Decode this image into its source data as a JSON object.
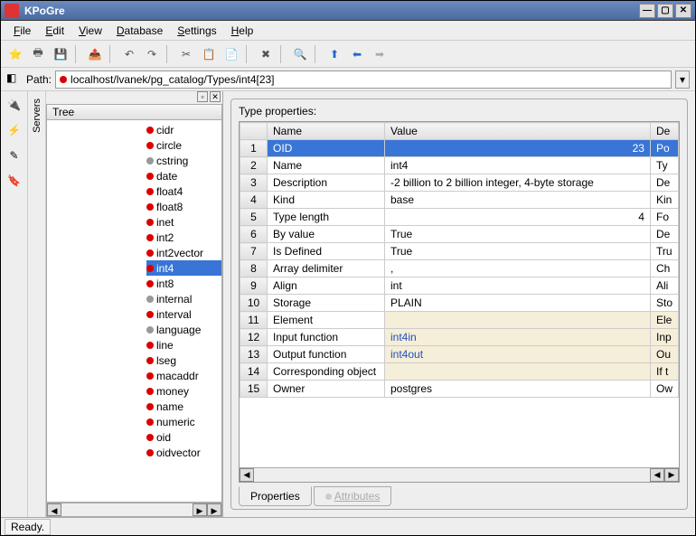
{
  "window": {
    "title": "KPoGre"
  },
  "menu": {
    "items": [
      "File",
      "Edit",
      "View",
      "Database",
      "Settings",
      "Help"
    ]
  },
  "path": {
    "label": "Path:",
    "value": "localhost/lvanek/pg_catalog/Types/int4[23]"
  },
  "sidebar": {
    "label": "Servers"
  },
  "tree": {
    "header": "Tree",
    "items": [
      {
        "name": "cidr",
        "color": "red"
      },
      {
        "name": "circle",
        "color": "red"
      },
      {
        "name": "cstring",
        "color": "grey"
      },
      {
        "name": "date",
        "color": "red"
      },
      {
        "name": "float4",
        "color": "red"
      },
      {
        "name": "float8",
        "color": "red"
      },
      {
        "name": "inet",
        "color": "red"
      },
      {
        "name": "int2",
        "color": "red"
      },
      {
        "name": "int2vector",
        "color": "red"
      },
      {
        "name": "int4",
        "color": "red",
        "selected": true
      },
      {
        "name": "int8",
        "color": "red"
      },
      {
        "name": "internal",
        "color": "grey"
      },
      {
        "name": "interval",
        "color": "red"
      },
      {
        "name": "language",
        "color": "grey"
      },
      {
        "name": "line",
        "color": "red"
      },
      {
        "name": "lseg",
        "color": "red"
      },
      {
        "name": "macaddr",
        "color": "red"
      },
      {
        "name": "money",
        "color": "red"
      },
      {
        "name": "name",
        "color": "red"
      },
      {
        "name": "numeric",
        "color": "red"
      },
      {
        "name": "oid",
        "color": "red"
      },
      {
        "name": "oidvector",
        "color": "red"
      }
    ]
  },
  "properties": {
    "title": "Type properties:",
    "columns": {
      "num": "",
      "name": "Name",
      "value": "Value",
      "desc": "De"
    },
    "rows": [
      {
        "n": "1",
        "name": "OID",
        "value": "23",
        "d": "Po",
        "selected": true,
        "ralign": true
      },
      {
        "n": "2",
        "name": "Name",
        "value": "int4",
        "d": "Ty"
      },
      {
        "n": "3",
        "name": "Description",
        "value": "-2 billion to 2 billion integer, 4-byte storage",
        "d": "De"
      },
      {
        "n": "4",
        "name": "Kind",
        "value": "base",
        "d": "Kin"
      },
      {
        "n": "5",
        "name": "Type length",
        "value": "4",
        "d": "Fo",
        "ralign": true
      },
      {
        "n": "6",
        "name": "By value",
        "value": "True",
        "d": "De"
      },
      {
        "n": "7",
        "name": "Is Defined",
        "value": "True",
        "d": "Tru"
      },
      {
        "n": "8",
        "name": "Array delimiter",
        "value": ",",
        "d": "Ch"
      },
      {
        "n": "9",
        "name": "Align",
        "value": "int",
        "d": "Ali"
      },
      {
        "n": "10",
        "name": "Storage",
        "value": "PLAIN",
        "d": "Sto"
      },
      {
        "n": "11",
        "name": "Element",
        "value": "",
        "d": "Ele",
        "highlight": true
      },
      {
        "n": "12",
        "name": "Input function",
        "value": "int4in",
        "d": "Inp",
        "highlight": true,
        "link": true
      },
      {
        "n": "13",
        "name": "Output function",
        "value": "int4out",
        "d": "Ou",
        "highlight": true,
        "link": true
      },
      {
        "n": "14",
        "name": "Corresponding object",
        "value": "",
        "d": "If t",
        "highlight": true
      },
      {
        "n": "15",
        "name": "Owner",
        "value": "postgres",
        "d": "Ow"
      }
    ]
  },
  "tabs": {
    "properties": "Properties",
    "attributes": "Attributes"
  },
  "status": {
    "text": "Ready."
  }
}
